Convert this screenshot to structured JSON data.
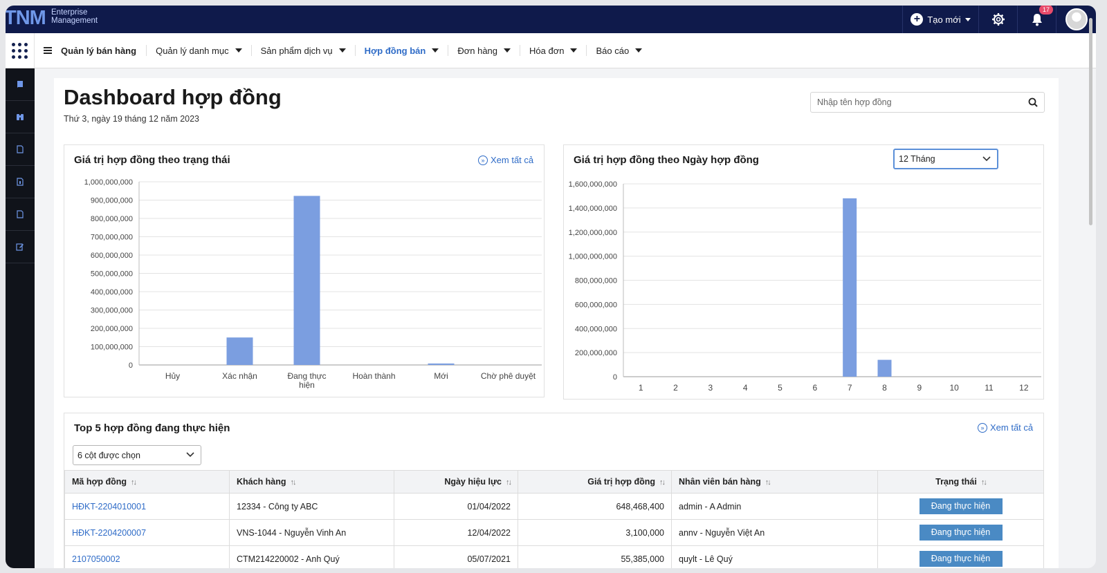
{
  "brand": {
    "logo": "TNM",
    "sub1": "Enterprise",
    "sub2": "Management"
  },
  "topbar": {
    "create_label": "Tạo mới",
    "notification_count": "17"
  },
  "menu": {
    "title": "Quản lý bán hàng",
    "items": [
      "Quản lý danh mục",
      "Sản phẩm dịch vụ",
      "Hợp đồng bán",
      "Đơn hàng",
      "Hóa đơn",
      "Báo cáo"
    ],
    "active_index": 2
  },
  "page": {
    "title": "Dashboard hợp đồng",
    "date": "Thứ 3, ngày 19 tháng 12 năm 2023",
    "search_placeholder": "Nhập tên hợp đồng"
  },
  "colors": {
    "topbar": "#0f1a4b",
    "accent": "#2e6bc7",
    "bar": "#7b9ee0",
    "status": "#4a8ac4"
  },
  "chart_data": [
    {
      "type": "bar",
      "title": "Giá trị hợp đồng theo trạng thái",
      "categories": [
        "Hủy",
        "Xác nhận",
        "Đang thực hiện",
        "Hoàn thành",
        "Mới",
        "Chờ phê duyệt"
      ],
      "values": [
        0,
        150000000,
        923000000,
        0,
        8000000,
        0
      ],
      "ylim": [
        0,
        1000000000
      ],
      "yticks": [
        "0",
        "100,000,000",
        "200,000,000",
        "300,000,000",
        "400,000,000",
        "500,000,000",
        "600,000,000",
        "700,000,000",
        "800,000,000",
        "900,000,000",
        "1,000,000,000"
      ],
      "see_all": "Xem tất cả",
      "grid": true
    },
    {
      "type": "bar",
      "title": "Giá trị hợp đồng theo Ngày hợp đồng",
      "categories": [
        "1",
        "2",
        "3",
        "4",
        "5",
        "6",
        "7",
        "8",
        "9",
        "10",
        "11",
        "12"
      ],
      "values": [
        0,
        0,
        0,
        0,
        0,
        0,
        1480000000,
        140000000,
        0,
        0,
        0,
        0
      ],
      "ylim": [
        0,
        1600000000
      ],
      "yticks": [
        "0",
        "200,000,000",
        "400,000,000",
        "600,000,000",
        "800,000,000",
        "1,000,000,000",
        "1,200,000,000",
        "1,400,000,000",
        "1,600,000,000"
      ],
      "period": "12 Tháng",
      "grid": true
    }
  ],
  "top5": {
    "title": "Top 5 hợp đồng đang thực hiện",
    "see_all": "Xem tất cả",
    "column_select": "6 cột được chọn",
    "headers": [
      "Mã hợp đồng",
      "Khách hàng",
      "Ngày hiệu lực",
      "Giá trị hợp đồng",
      "Nhân viên bán hàng",
      "Trạng thái"
    ],
    "rows": [
      {
        "code": "HĐKT-2204010001",
        "customer": "12334 - Công ty ABC",
        "date": "01/04/2022",
        "value": "648,468,400",
        "staff": "admin - A Admin",
        "status": "Đang thực hiện"
      },
      {
        "code": "HĐKT-2204200007",
        "customer": "VNS-1044 - Nguyễn Vinh An",
        "date": "12/04/2022",
        "value": "3,100,000",
        "staff": "annv - Nguyễn Việt An",
        "status": "Đang thực hiện"
      },
      {
        "code": "2107050002",
        "customer": "CTM214220002 - Anh Quý",
        "date": "05/07/2021",
        "value": "55,385,000",
        "staff": "quylt - Lê Quý",
        "status": "Đang thực hiện"
      }
    ]
  }
}
